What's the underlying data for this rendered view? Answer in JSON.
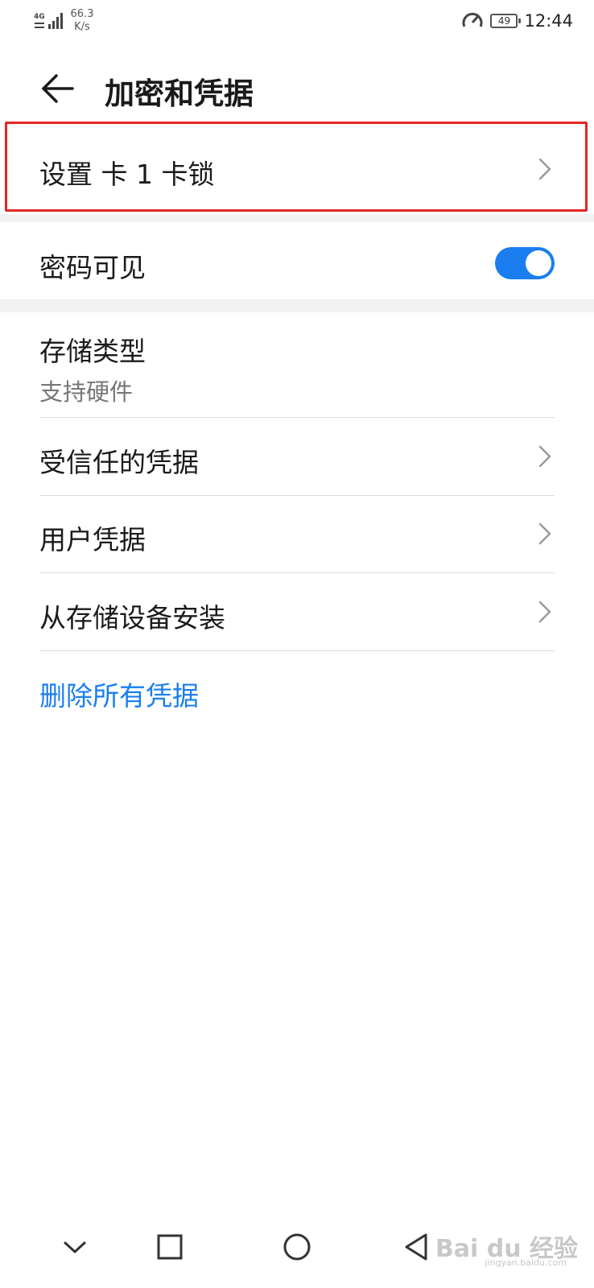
{
  "status_bar": {
    "network": "4G",
    "speed_value": "66.3",
    "speed_unit": "K/s",
    "battery": "49",
    "time": "12:44"
  },
  "header": {
    "title": "加密和凭据"
  },
  "items": {
    "sim_lock": "设置 卡 1 卡锁",
    "password_visible": "密码可见",
    "password_visible_on": true,
    "storage_type": "存储类型",
    "storage_type_value": "支持硬件",
    "trusted_credentials": "受信任的凭据",
    "user_credentials": "用户凭据",
    "install_from_storage": "从存储设备安装",
    "clear_credentials": "删除所有凭据"
  },
  "colors": {
    "accent": "#1a7ef0",
    "highlight": "#e52525"
  },
  "watermark": {
    "brand": "Bai du 经验",
    "url": "jingyan.baidu.com"
  }
}
